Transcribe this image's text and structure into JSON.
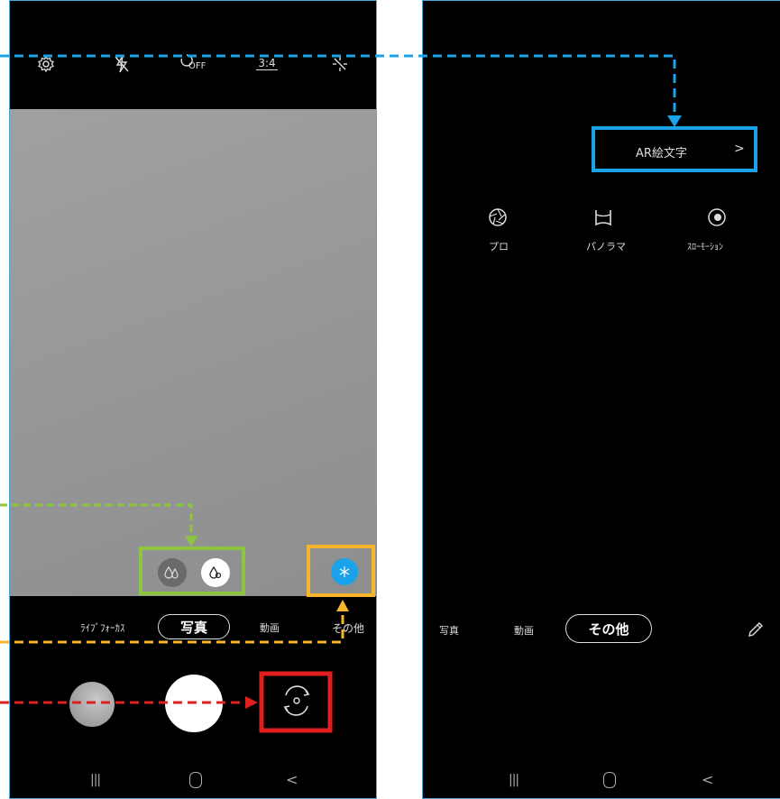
{
  "left_screen": {
    "top_bar": {
      "settings_icon": "gear-icon",
      "flash_icon": "flash-off-icon",
      "timer_label": "OFF",
      "ratio_label": "3:4",
      "effects_icon": "sparkle-off-icon"
    },
    "effects": {
      "blur_off_icon": "drops-outline-icon",
      "blur_on_icon": "drop-icon",
      "filter_icon": "filter-icon"
    },
    "modes": [
      "ﾗｲﾌﾞﾌｫｰｶｽ",
      "写真",
      "動画",
      "その他"
    ],
    "selected_mode": "写真",
    "buttons": {
      "gallery": "gallery-thumbnail",
      "shutter": "shutter-button",
      "switch": "switch-camera-icon"
    }
  },
  "right_screen": {
    "ar_emoji_label": "AR絵文字",
    "ar_chevron": ">",
    "mode_items": [
      {
        "label": "プロ",
        "icon": "aperture-icon"
      },
      {
        "label": "パノラマ",
        "icon": "panorama-icon"
      },
      {
        "label": "ｽﾛｰﾓｰｼｮﾝ",
        "icon": "slow-motion-icon"
      }
    ],
    "modes": [
      "写真",
      "動画",
      "その他"
    ],
    "selected_mode": "その他",
    "edit_icon": "pencil-icon"
  },
  "navigation": [
    "|||",
    "○",
    "<"
  ],
  "colors": {
    "blue": "#1aa3e8",
    "green": "#8cc63f",
    "orange": "#f7b52c",
    "red": "#e0201e",
    "phone_bg": "#000000",
    "preview_gray": "#9a9a9a"
  }
}
